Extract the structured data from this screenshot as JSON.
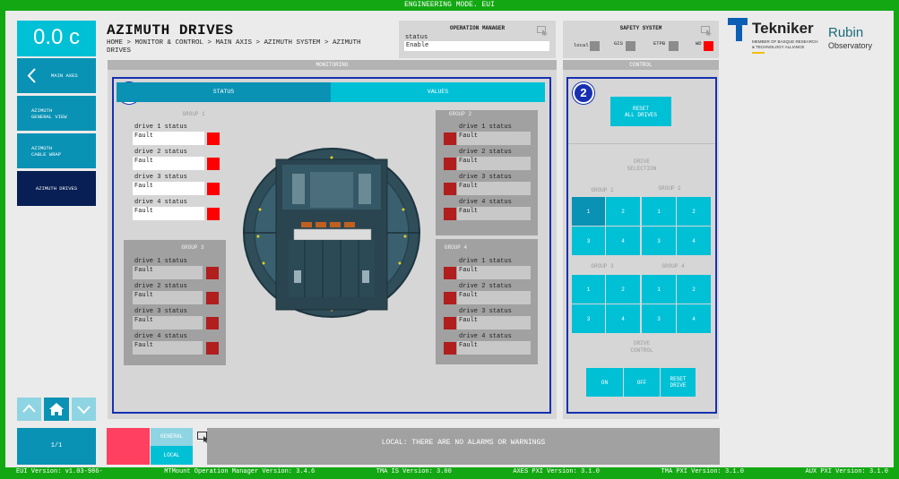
{
  "topbar": {
    "mode": "ENGINEERING MODE. EUI"
  },
  "left_nav": {
    "speed": "0.0 c",
    "items": [
      {
        "label": "MAIN AXES"
      },
      {
        "label": "AZIMUTH\nGENERAL VIEW"
      },
      {
        "label": "AZIMUTH\nCABLE WRAP"
      },
      {
        "label": "AZIMUTH DRIVES"
      }
    ],
    "page": "1/1"
  },
  "header": {
    "title": "AZIMUTH DRIVES",
    "breadcrumb": "HOME > MONITOR & CONTROL > MAIN AXIS > AZIMUTH SYSTEM > AZIMUTH DRIVES"
  },
  "operation_manager": {
    "title": "OPERATION MANAGER",
    "status_label": "status",
    "status_value": "Enable"
  },
  "safety_system": {
    "title": "SAFETY SYSTEM",
    "items": [
      {
        "label": "local",
        "color": "#8c8c8c"
      },
      {
        "label": "GIS",
        "color": "#8c8c8c"
      },
      {
        "label": "ETPB",
        "color": "#8c8c8c"
      },
      {
        "label": "WD",
        "color": "#ff0000"
      }
    ]
  },
  "logos": {
    "tekniker": "Tekniker",
    "tekniker_sub": "MEMBER OF BASQUE RESEARCH\n& TECHNOLOGY ALLIANCE",
    "rubin1": "Rubin",
    "rubin2": "Observatory"
  },
  "monitoring": {
    "title": "MONITORING",
    "badge": "1",
    "tabs": [
      "STATUS",
      "VALUES"
    ],
    "groups": [
      {
        "title": "GROUP 1",
        "drives": [
          {
            "label": "drive 1 status",
            "value": "Fault",
            "color": "#ff0000"
          },
          {
            "label": "drive 2 status",
            "value": "Fault",
            "color": "#ff0000"
          },
          {
            "label": "drive 3 status",
            "value": "Fault",
            "color": "#ff0000"
          },
          {
            "label": "drive 4 status",
            "value": "Fault",
            "color": "#ff0000"
          }
        ]
      },
      {
        "title": "GROUP 2",
        "drives": [
          {
            "label": "drive 1 status",
            "value": "Fault",
            "color": "#b01e1e"
          },
          {
            "label": "drive 2 status",
            "value": "Fault",
            "color": "#b01e1e"
          },
          {
            "label": "drive 3 status",
            "value": "Fault",
            "color": "#b01e1e"
          },
          {
            "label": "drive 4 status",
            "value": "Fault",
            "color": "#b01e1e"
          }
        ]
      },
      {
        "title": "GROUP 3",
        "drives": [
          {
            "label": "drive 1 status",
            "value": "Fault",
            "color": "#b01e1e"
          },
          {
            "label": "drive 2 status",
            "value": "Fault",
            "color": "#b01e1e"
          },
          {
            "label": "drive 3 status",
            "value": "Fault",
            "color": "#b01e1e"
          },
          {
            "label": "drive 4 status",
            "value": "Fault",
            "color": "#b01e1e"
          }
        ]
      },
      {
        "title": "GROUP 4",
        "drives": [
          {
            "label": "drive 1 status",
            "value": "Fault",
            "color": "#b01e1e"
          },
          {
            "label": "drive 2 status",
            "value": "Fault",
            "color": "#b01e1e"
          },
          {
            "label": "drive 3 status",
            "value": "Fault",
            "color": "#b01e1e"
          },
          {
            "label": "drive 4 status",
            "value": "Fault",
            "color": "#b01e1e"
          }
        ]
      }
    ]
  },
  "control": {
    "title": "CONTROL",
    "badge": "2",
    "reset_all": "RESET\nALL DRIVES",
    "drive_selection": "DRIVE\nSELECTION",
    "groups": [
      {
        "title": "GROUP 1",
        "buttons": [
          "1",
          "2",
          "3",
          "4"
        ]
      },
      {
        "title": "GROUP 2",
        "buttons": [
          "1",
          "2",
          "3",
          "4"
        ]
      },
      {
        "title": "GROUP 3",
        "buttons": [
          "1",
          "2",
          "3",
          "4"
        ]
      },
      {
        "title": "GROUP 4",
        "buttons": [
          "1",
          "2",
          "3",
          "4"
        ]
      }
    ],
    "drive_control": "DRIVE\nCONTROL",
    "on": "ON",
    "off": "OFF",
    "reset_drive": "RESET\nDRIVE"
  },
  "alarm_bar": {
    "general": "GENERAL",
    "local": "LOCAL",
    "message": "LOCAL: THERE ARE NO ALARMS OR WARNINGS"
  },
  "footer": {
    "eui": "EUI Version: v1.03-986-",
    "mtmount": "MTMount Operation Manager Version: 3.4.6",
    "tma_is": "TMA IS Version: 3.00",
    "axes_pxi": "AXES PXI Version: 3.1.0",
    "tma_pxi": "TMA PXI Version: 3.1.0",
    "aux_pxi": "AUX PXI Version: 3.1.0"
  }
}
